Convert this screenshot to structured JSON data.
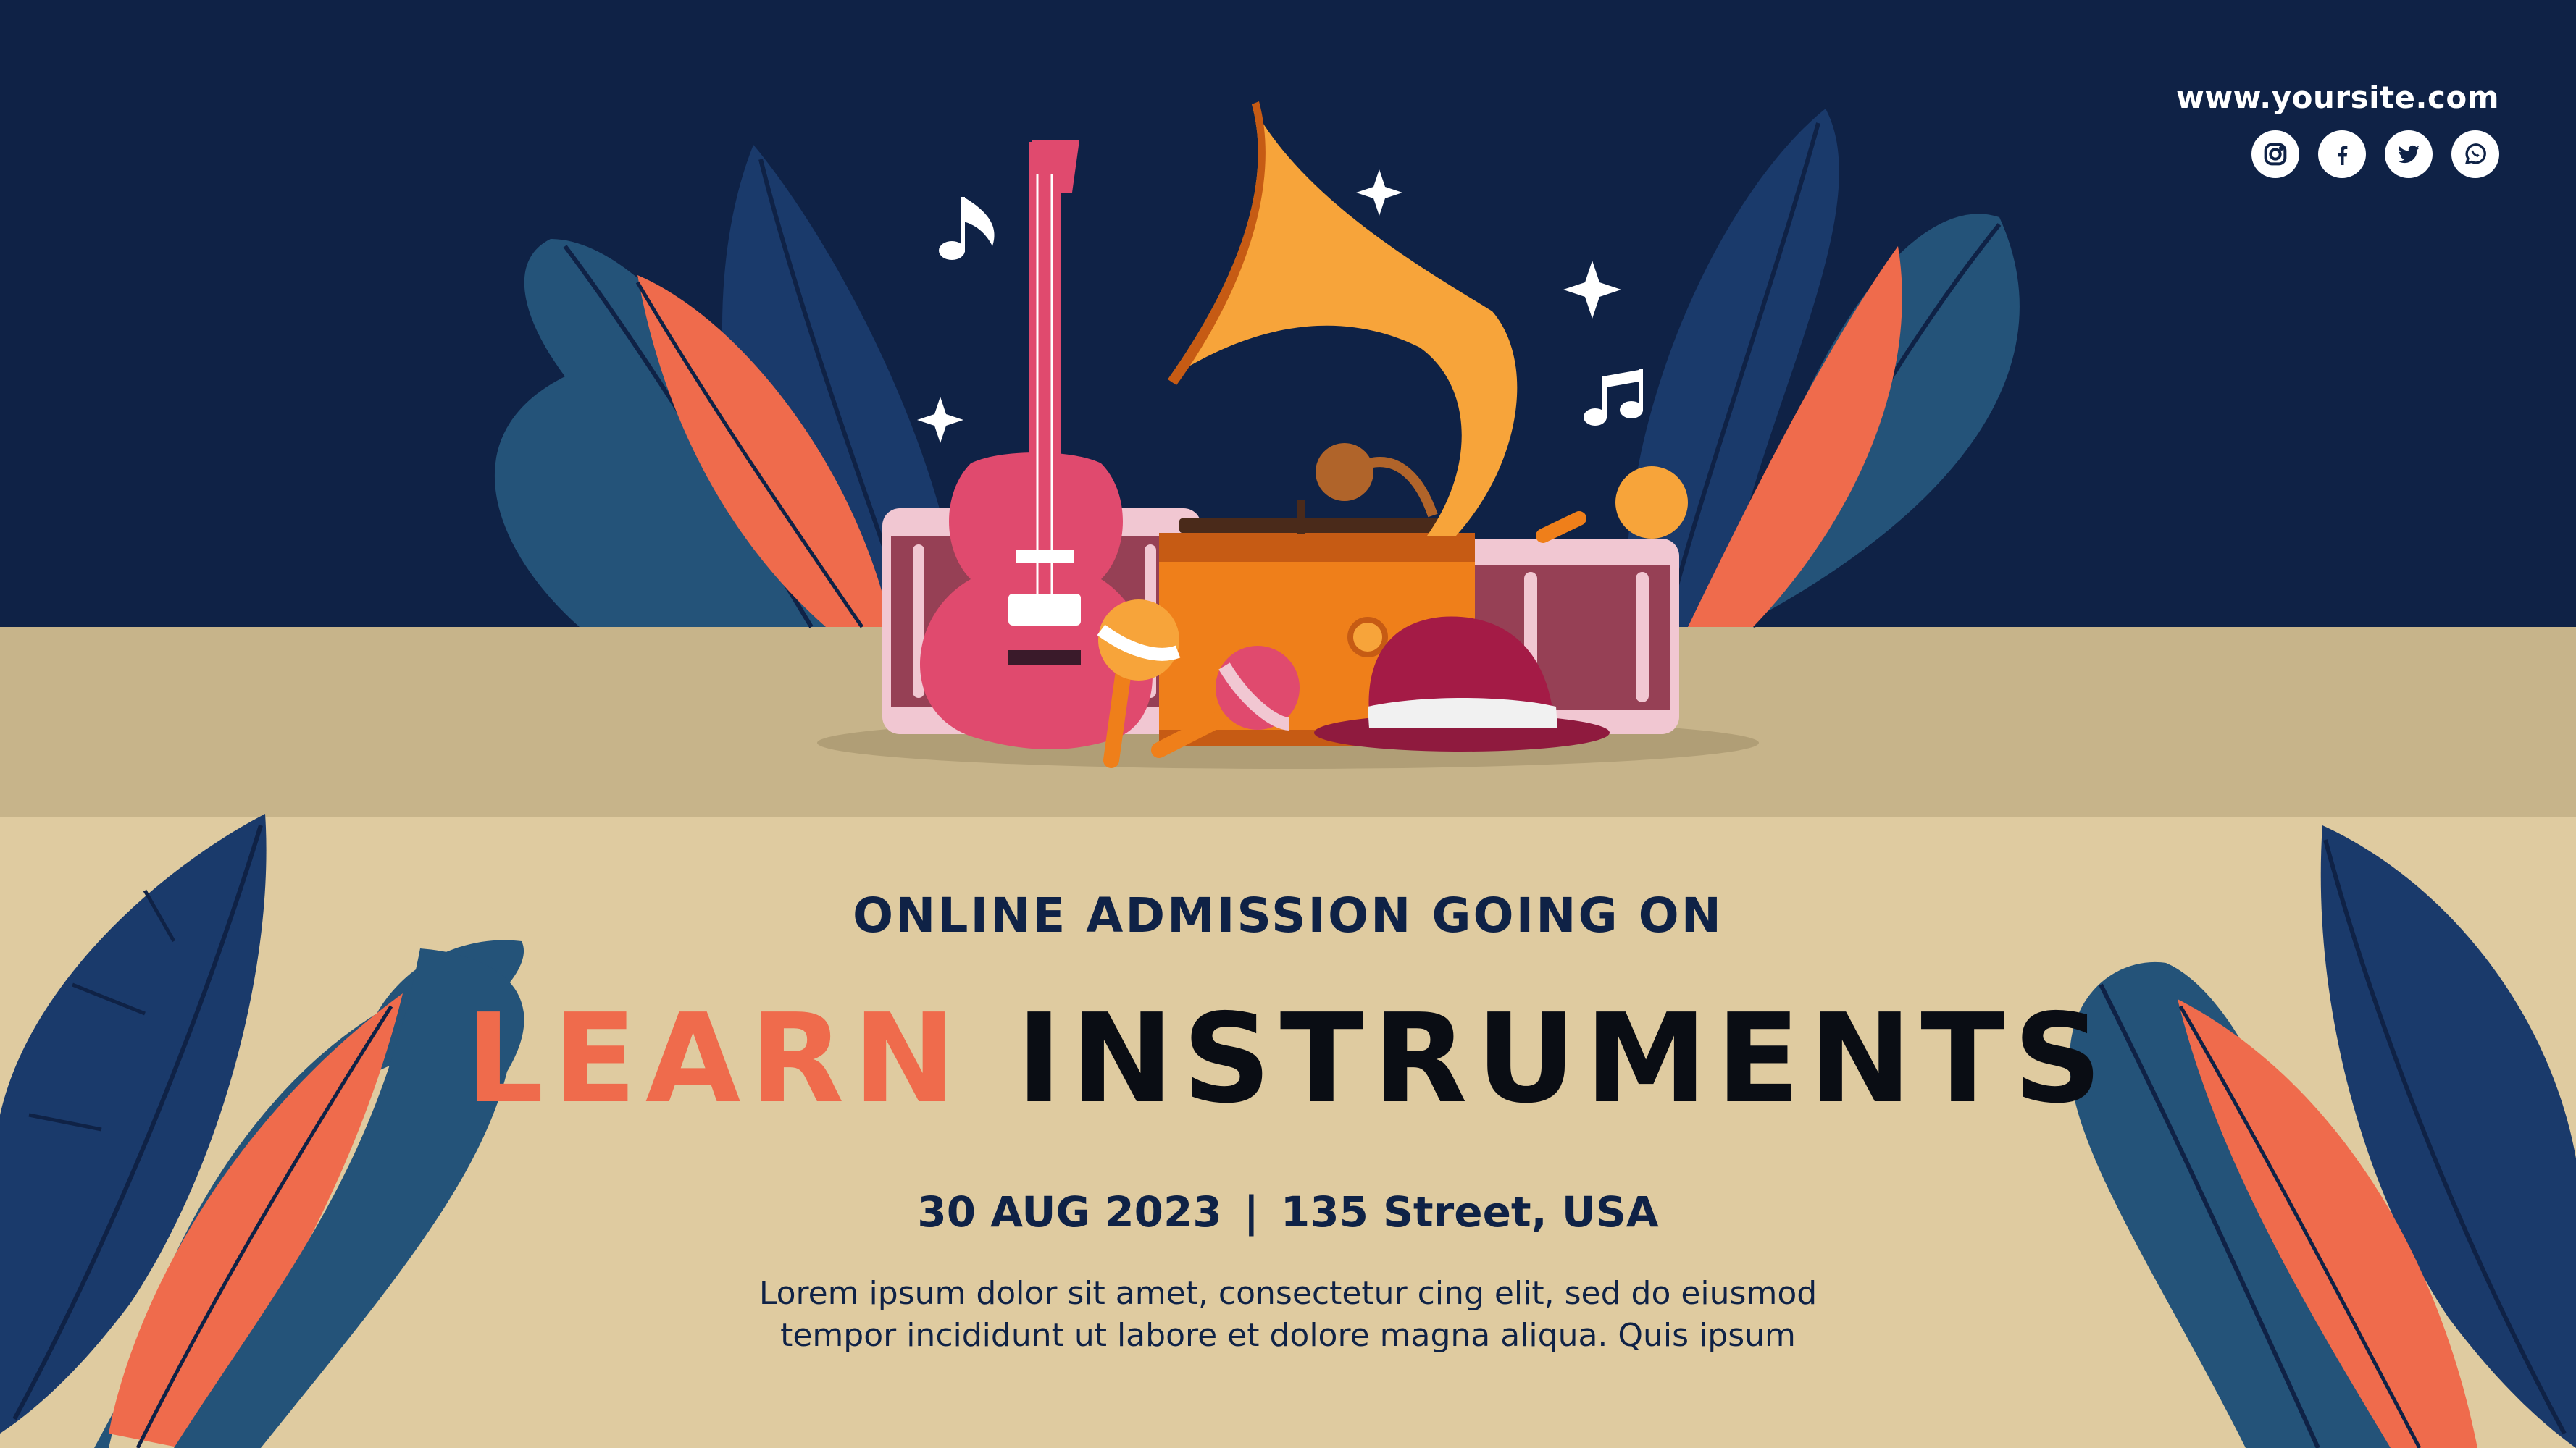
{
  "header": {
    "website": "www.yoursite.com",
    "social_icons": [
      "instagram-icon",
      "facebook-icon",
      "twitter-icon",
      "whatsapp-icon"
    ]
  },
  "main": {
    "subtitle": "ONLINE ADMISSION GOING ON",
    "title_accent": "LEARN",
    "title_main": "INSTRUMENTS",
    "date": "30 AUG 2023",
    "separator": "|",
    "location": "135 Street, USA",
    "description_line1": "Lorem ipsum dolor sit amet, consectetur cing elit, sed do eiusmod",
    "description_line2": "tempor incididunt ut labore et dolore magna aliqua. Quis ipsum"
  },
  "colors": {
    "navy": "#0f2246",
    "coral": "#ef6b4c",
    "sand": "#dfcba0",
    "shelf": "#c7b48a",
    "leaf_blue": "#1a3a6b",
    "leaf_teal": "#245379"
  },
  "illustration": {
    "items": [
      "guitar-icon",
      "gramophone-icon",
      "drum-icon",
      "maracas-icon",
      "hat-icon",
      "music-note-icon",
      "sparkle-icon",
      "leaf-icon"
    ]
  }
}
